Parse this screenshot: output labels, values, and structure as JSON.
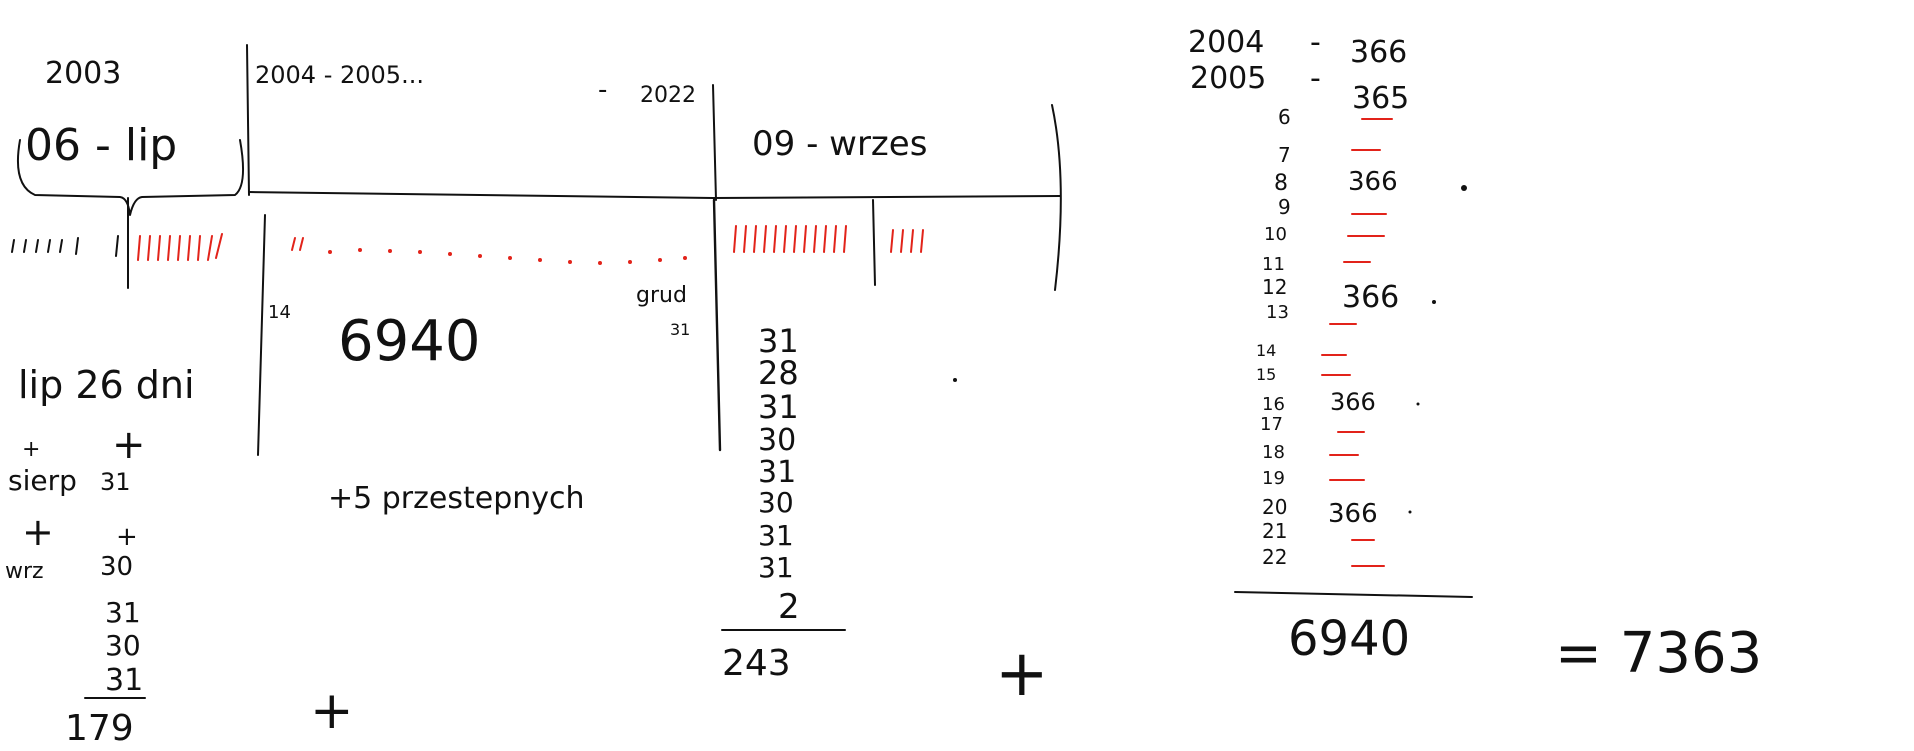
{
  "colors": {
    "ink": "#111111",
    "accent_red": "#e2231a",
    "background": "#ffffff"
  },
  "header": {
    "year_2003": "2003",
    "first_segment": "06 - lip",
    "middle_years": "2004 - 2005...",
    "year_2022_prefix": "-",
    "year_2022": "2022",
    "last_segment": "09 - wrzes"
  },
  "timeline": {
    "start_mark": "14",
    "end_mark": "grud",
    "end_day": "31",
    "middle_total": "6940",
    "leap_note": "+5 przestepnych"
  },
  "left_sum": {
    "first_line": "lip 26 dni",
    "plus_1": "+",
    "plus_1b": "+",
    "siep_label": "sierp",
    "siep_value": "31",
    "plus_2": "+",
    "plus_2b": "+",
    "wrz_label": "wrz",
    "wrz_value": "30",
    "values": [
      "31",
      "30",
      "31"
    ],
    "total": "179",
    "plus_after": "+"
  },
  "right_sum": {
    "values": [
      "31",
      "28",
      "31",
      "30",
      "31",
      "30",
      "31",
      "31",
      "2"
    ],
    "total": "243",
    "plus_after": "+"
  },
  "years_list": {
    "rows": [
      {
        "year": "2004",
        "days": "366"
      },
      {
        "year": "2005",
        "days": "365"
      },
      {
        "year": "6",
        "days": ""
      },
      {
        "year": "7",
        "days": ""
      },
      {
        "year": "8",
        "days": "366"
      },
      {
        "year": "9",
        "days": ""
      },
      {
        "year": "10",
        "days": ""
      },
      {
        "year": "11",
        "days": ""
      },
      {
        "year": "12",
        "days": "366"
      },
      {
        "year": "13",
        "days": ""
      },
      {
        "year": "14",
        "days": ""
      },
      {
        "year": "15",
        "days": ""
      },
      {
        "year": "16",
        "days": "366"
      },
      {
        "year": "17",
        "days": ""
      },
      {
        "year": "18",
        "days": ""
      },
      {
        "year": "19",
        "days": ""
      },
      {
        "year": "20",
        "days": "366"
      },
      {
        "year": "21",
        "days": ""
      },
      {
        "year": "22",
        "days": ""
      }
    ],
    "dash": "-",
    "total": "6940",
    "equals": "= 7363"
  }
}
